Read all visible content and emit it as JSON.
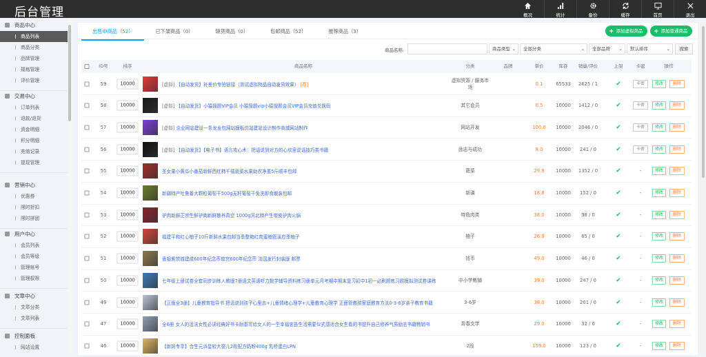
{
  "header": {
    "title": "后台管理",
    "nav": [
      {
        "label": "概况",
        "icon": "home-icon"
      },
      {
        "label": "统计",
        "icon": "bar-chart-icon"
      },
      {
        "label": "备份",
        "icon": "gear-icon"
      },
      {
        "label": "缓存",
        "icon": "refresh-icon"
      },
      {
        "label": "首页",
        "icon": "monitor-icon"
      },
      {
        "label": "退出",
        "icon": "close-icon"
      }
    ]
  },
  "sidebar": [
    {
      "title": "商品中心",
      "items": [
        "商品列表",
        "商品分类",
        "品牌管理",
        "规格管理",
        "评价管理"
      ],
      "active": 0
    },
    {
      "title": "交易中心",
      "items": [
        "订单列表",
        "退款/退货",
        "资金明细",
        "积分明细",
        "充值记录",
        "提现管理"
      ]
    },
    {
      "title": "营销中心",
      "items": [
        "优惠券",
        "限时折扣",
        "限时拼团"
      ]
    },
    {
      "title": "用户中心",
      "items": [
        "会员列表",
        "会员等级",
        "管理帐号",
        "管理权限"
      ]
    },
    {
      "title": "文章中心",
      "items": [
        "文章分类",
        "文章列表"
      ]
    },
    {
      "title": "控制面板",
      "items": [
        "网站设置"
      ]
    }
  ],
  "tabs": [
    "出售中商品（52）",
    "已下架商品（0）",
    "缺货商品（0）",
    "包邮商品（52）",
    "推荐商品（3）"
  ],
  "buttons": {
    "add_virtual": "添加虚拟商品",
    "add_normal": "添加普通商品",
    "search": "搜索",
    "card": "卡密",
    "edit": "修改",
    "delete": "删除"
  },
  "filters": {
    "name_label": "商品名称:",
    "name_value": "",
    "type": "商品类型",
    "category": "全部分类",
    "brand": "全部品牌",
    "sort": "默认排序"
  },
  "columns": [
    "ID号",
    "排序",
    "商品名称",
    "分类",
    "品牌",
    "单价",
    "库存",
    "销量/评价",
    "上架",
    "卡密",
    "操作"
  ],
  "rows": [
    {
      "id": "59",
      "sort": "10000",
      "prefix": "[虚拟]",
      "tag": "【自动发货】",
      "name": "补差价专拍链接（测试虚拟物品自动发货效果）",
      "suffix": "[荐]",
      "category": "虚拟资源 / 服务市场",
      "price": "0.1",
      "stock": "65533",
      "sales": "2625 / 1",
      "card": "卡密",
      "color": "#e53935"
    },
    {
      "id": "58",
      "sort": "10000",
      "prefix": "[虚拟]",
      "tag": "【自动发货】",
      "name": "小猿搜题VIP会员 小猿搜题vip小猿搜题会员VIP会员充值兑换码",
      "suffix": "",
      "category": "其它会员",
      "price": "0.5",
      "stock": "10000",
      "sales": "1412 / 0",
      "card": "卡密",
      "color": "#1a1a1a"
    },
    {
      "id": "57",
      "sort": "10000",
      "prefix": "[虚拟]",
      "tag": "",
      "name": "企业网站建设一条龙全包网站模板仿站建站设计制作商城网站制作",
      "suffix": "",
      "category": "网站开发",
      "price": "100.0",
      "stock": "10000",
      "sales": "2046 / 0",
      "card": "卡密",
      "color": "#7b3fd6"
    },
    {
      "id": "56",
      "sort": "10000",
      "prefix": "[虚拟]",
      "tag": "【自动发货】",
      "name": "【电子书】语言攻心术：把话说到对方的心坎里说话技巧类书籍",
      "suffix": "",
      "category": "励志与成功",
      "price": "8.0",
      "stock": "10000",
      "sales": "241 / 0",
      "card": "卡密",
      "color": "#111"
    },
    {
      "id": "55",
      "sort": "10000",
      "prefix": "",
      "tag": "",
      "name": "圣女果小黄瓜小番茄新鲜西红柿千禧蔬菜水果助农净重5斤顺丰包邮",
      "suffix": "",
      "category": "蔬菜",
      "price": "29.9",
      "stock": "10000",
      "sales": "1352 / 0",
      "card": "-",
      "color": "#a52a2a"
    },
    {
      "id": "54",
      "sort": "10000",
      "prefix": "",
      "tag": "",
      "name": "新疆特产吐鲁番大颗粒葡萄干500g无籽葡萄干免洗即食散装包邮",
      "suffix": "",
      "category": "新疆",
      "price": "18.8",
      "stock": "10000",
      "sales": "152 / 0",
      "card": "-",
      "color": "#6b7b2a"
    },
    {
      "id": "53",
      "sort": "10000",
      "prefix": "",
      "tag": "",
      "name": "驴肉新鲜正宗生鲜驴肉新鲜散养真空 1000g河北特产生带皮驴肉火锅",
      "suffix": "",
      "category": "特色肉类",
      "price": "38.0",
      "stock": "10000",
      "sales": "98 / 0",
      "card": "-",
      "color": "#8b2030"
    },
    {
      "id": "52",
      "sort": "10000",
      "prefix": "",
      "tag": "",
      "name": "福建平和红心柚子10斤新鲜水果包邮当季整箱红肉蜜柚管溪应季柚子",
      "suffix": "",
      "category": "柚子",
      "price": "26.9",
      "stock": "10000",
      "sales": "65 / 0",
      "card": "-",
      "color": "#d2473a"
    },
    {
      "id": "51",
      "sort": "10000",
      "prefix": "",
      "tag": "",
      "name": "香银紫禁城建成600年纪念币故宫600年纪念币 法国发行封装版 邮票",
      "suffix": "",
      "category": "钱币",
      "price": "49.0",
      "stock": "10000",
      "sales": "46 / 0",
      "card": "-",
      "color": "#8a7a50"
    },
    {
      "id": "50",
      "sort": "10000",
      "prefix": "",
      "tag": "",
      "name": "七年级上册试卷全套同步训练人教版7册语文英语听力数学辅导资料练习册单元月考期中期末复习初中1初一必刷题练习题模拟测试卷课练",
      "suffix": "",
      "category": "中小学教辅",
      "price": "39.0",
      "stock": "10000",
      "sales": "247 / 0",
      "card": "-",
      "color": "#3d7ab8"
    },
    {
      "id": "49",
      "sort": "10000",
      "prefix": "",
      "tag": "",
      "name": "【正版全3册】儿童教育指导书 把话说到孩子心里去+儿童情绪心理学+儿童教育心理学 正面管教孩家庭教育方法0-3-6岁亲子教育书籍",
      "suffix": "",
      "category": "3-6岁",
      "price": "38.0",
      "stock": "10000",
      "sales": "201 / 0",
      "card": "-",
      "color": "#b8c4d4"
    },
    {
      "id": "47",
      "sort": "10000",
      "prefix": "",
      "tag": "",
      "name": "全6册 女人的活法女性必读经典好书卡耐基写给女人的一生幸福忠告生活需要仪式感适合女生看的书提升自己修养气质励志书籍畅销书",
      "suffix": "",
      "category": "青春文学",
      "price": "29.0",
      "stock": "10000",
      "sales": "32 / 0",
      "card": "-",
      "color": "#8fa0b8"
    },
    {
      "id": "46",
      "sort": "10000",
      "prefix": "",
      "tag": "",
      "name": "【新妈专享】合生元派星较大婴儿2段配方奶粉400g 乳桥蛋白LPN",
      "suffix": "",
      "category": "2段",
      "price": "159.0",
      "stock": "10000",
      "sales": "123 / 0",
      "card": "-",
      "color": "#e0b860"
    }
  ]
}
